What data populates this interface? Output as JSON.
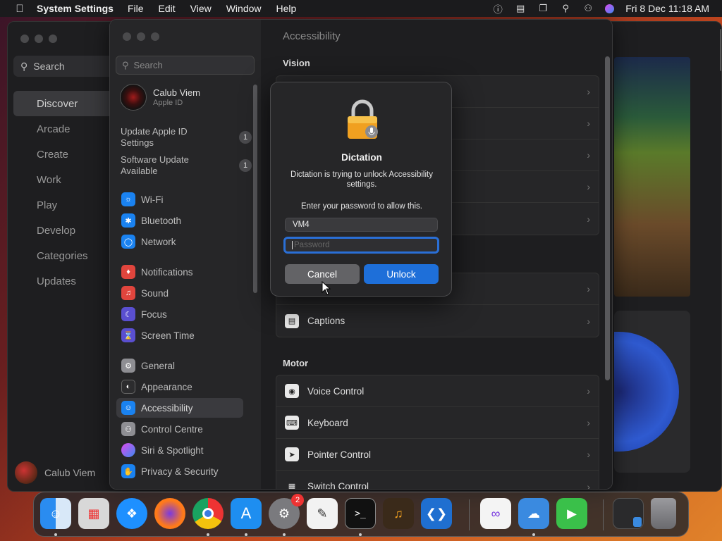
{
  "menubar": {
    "app": "System Settings",
    "menus": [
      "File",
      "Edit",
      "View",
      "Window",
      "Help"
    ],
    "clock": "Fri 8 Dec  11:18 AM",
    "icons": [
      "accessibility-icon",
      "display-icon",
      "stage-manager-icon",
      "search-icon",
      "control-centre-icon",
      "siri-icon"
    ]
  },
  "appstore": {
    "search_placeholder": "Search",
    "nav": [
      "Discover",
      "Arcade",
      "Create",
      "Work",
      "Play",
      "Develop",
      "Categories",
      "Updates"
    ],
    "active_nav": "Discover",
    "user": "Calub Viem"
  },
  "sidebar": {
    "search_placeholder": "Search",
    "account": {
      "name": "Calub Viem",
      "sub": "Apple ID"
    },
    "notices": [
      {
        "label": "Update Apple ID Settings",
        "badge": "1"
      },
      {
        "label": "Software Update Available",
        "badge": "1"
      }
    ],
    "items": [
      {
        "label": "Wi-Fi",
        "icon": "wifi-icon",
        "color": "#1a82f0"
      },
      {
        "label": "Bluetooth",
        "icon": "bluetooth-icon",
        "color": "#1a82f0"
      },
      {
        "label": "Network",
        "icon": "globe-icon",
        "color": "#1a82f0"
      },
      {
        "label": "Notifications",
        "icon": "bell-icon",
        "color": "#e0453d"
      },
      {
        "label": "Sound",
        "icon": "speaker-icon",
        "color": "#e0453d"
      },
      {
        "label": "Focus",
        "icon": "moon-icon",
        "color": "#5a4fd0"
      },
      {
        "label": "Screen Time",
        "icon": "hourglass-icon",
        "color": "#5a4fd0"
      },
      {
        "label": "General",
        "icon": "gear-icon",
        "color": "#8e8e93"
      },
      {
        "label": "Appearance",
        "icon": "appearance-icon",
        "color": "#2c2c2e"
      },
      {
        "label": "Accessibility",
        "icon": "accessibility-icon",
        "color": "#1a82f0"
      },
      {
        "label": "Control Centre",
        "icon": "control-centre-icon",
        "color": "#8e8e93"
      },
      {
        "label": "Siri & Spotlight",
        "icon": "siri-icon",
        "color": "#c43be0"
      },
      {
        "label": "Privacy & Security",
        "icon": "hand-icon",
        "color": "#1a82f0"
      }
    ],
    "active": "Accessibility"
  },
  "content": {
    "title": "Accessibility",
    "sections": {
      "vision": "Vision",
      "motor": "Motor"
    },
    "hearing_rows": [
      {
        "label": "Captions",
        "icon": "captions-icon"
      }
    ],
    "motor_rows": [
      {
        "label": "Voice Control",
        "icon": "voice-control-icon"
      },
      {
        "label": "Keyboard",
        "icon": "keyboard-icon"
      },
      {
        "label": "Pointer Control",
        "icon": "pointer-icon"
      },
      {
        "label": "Switch Control",
        "icon": "switch-icon"
      }
    ]
  },
  "dialog": {
    "title": "Dictation",
    "message": "Dictation is trying to unlock Accessibility settings.",
    "prompt": "Enter your password to allow this.",
    "username": "VM4",
    "password_placeholder": "Password",
    "cancel": "Cancel",
    "unlock": "Unlock"
  },
  "dock": {
    "apps": [
      {
        "name": "finder-icon",
        "color": "#2a8cf0"
      },
      {
        "name": "launchpad-icon",
        "color": "#d8d8d8"
      },
      {
        "name": "safari-icon",
        "color": "#1e90ff"
      },
      {
        "name": "firefox-icon",
        "color": "#ff7a1a"
      },
      {
        "name": "chrome-icon",
        "color": "#e8e8e8"
      },
      {
        "name": "app-store-icon",
        "color": "#1e8ef0"
      },
      {
        "name": "system-settings-icon",
        "color": "#7a7a7e",
        "badge": "2"
      },
      {
        "name": "textedit-icon",
        "color": "#f2f2f2"
      },
      {
        "name": "terminal-icon",
        "color": "#111111"
      },
      {
        "name": "garageband-icon",
        "color": "#3a2a1a"
      },
      {
        "name": "vscode-icon",
        "color": "#1f6fd0"
      },
      {
        "name": "visual-studio-icon",
        "color": "#f4f4f4"
      },
      {
        "name": "weather-icon",
        "color": "#3a8ae0"
      },
      {
        "name": "facetime-icon",
        "color": "#3ac04a"
      },
      {
        "name": "downloads-icon",
        "color": "#2a2a2c"
      },
      {
        "name": "trash-icon",
        "color": "#8e8e93"
      }
    ]
  }
}
